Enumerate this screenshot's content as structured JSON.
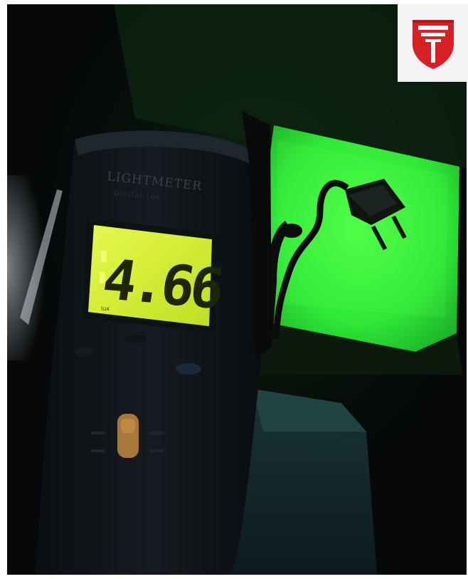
{
  "image": {
    "scene": "lux meter reading next to glowing green panel",
    "meter": {
      "brand_text": "LIGHTMETER",
      "model_text": "DIGITAL LUX",
      "reading": "4.66",
      "unit_indicator": "lux"
    },
    "colors": {
      "lcd_backlight": "#d8f23a",
      "panel_glow": "#39ff3a",
      "logo_red": "#d81f26",
      "background": "#060809"
    }
  }
}
